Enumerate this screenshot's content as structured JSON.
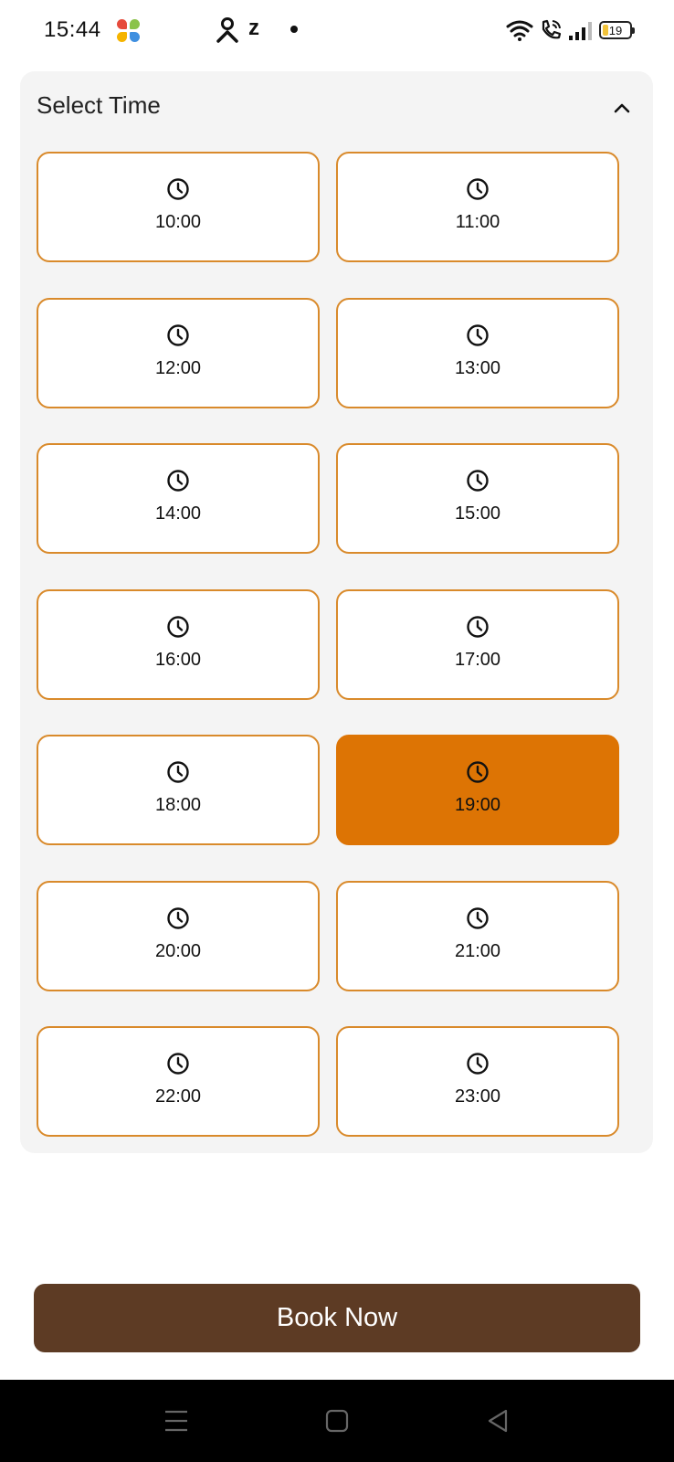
{
  "status_bar": {
    "time": "15:44",
    "z_label": "z",
    "battery_level": "19"
  },
  "time_picker": {
    "title": "Select Time",
    "selected": "19:00",
    "slots": [
      {
        "label": "10:00",
        "selected": false
      },
      {
        "label": "11:00",
        "selected": false
      },
      {
        "label": "12:00",
        "selected": false
      },
      {
        "label": "13:00",
        "selected": false
      },
      {
        "label": "14:00",
        "selected": false
      },
      {
        "label": "15:00",
        "selected": false
      },
      {
        "label": "16:00",
        "selected": false
      },
      {
        "label": "17:00",
        "selected": false
      },
      {
        "label": "18:00",
        "selected": false
      },
      {
        "label": "19:00",
        "selected": true
      },
      {
        "label": "20:00",
        "selected": false
      },
      {
        "label": "21:00",
        "selected": false
      },
      {
        "label": "22:00",
        "selected": false
      },
      {
        "label": "23:00",
        "selected": false
      }
    ]
  },
  "actions": {
    "book_label": "Book Now"
  },
  "colors": {
    "accent": "#dd7404",
    "slot_border": "#d98a2b",
    "book_button": "#5d3b24",
    "card_background": "#f4f4f4"
  },
  "icons": {
    "collapse": "chevron-up-icon",
    "slot": "clock-icon",
    "nav": [
      "menu-icon",
      "home-square-icon",
      "back-triangle-icon"
    ]
  }
}
